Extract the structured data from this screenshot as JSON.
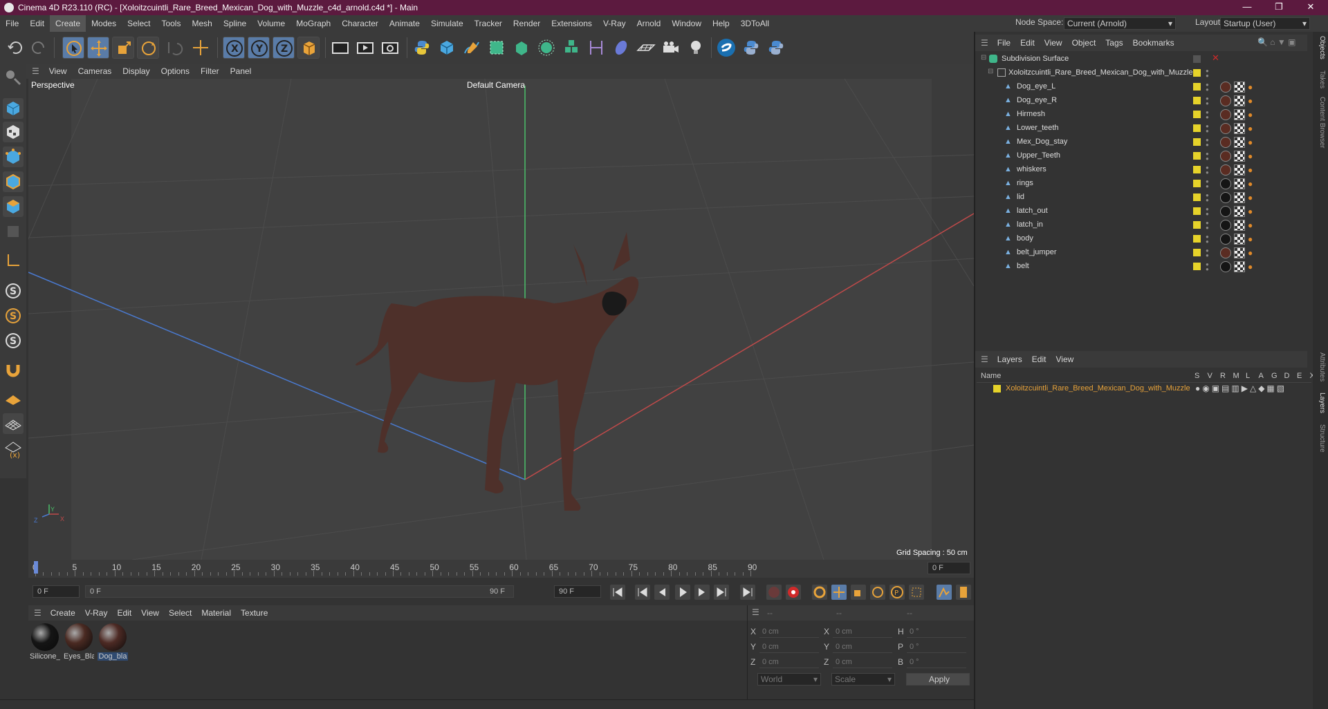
{
  "app": {
    "title": "Cinema 4D R23.110 (RC) - [Xoloitzcuintli_Rare_Breed_Mexican_Dog_with_Muzzle_c4d_arnold.c4d *] - Main"
  },
  "menubar": {
    "items": [
      "File",
      "Edit",
      "Create",
      "Modes",
      "Select",
      "Tools",
      "Mesh",
      "Spline",
      "Volume",
      "MoGraph",
      "Character",
      "Animate",
      "Simulate",
      "Tracker",
      "Render",
      "Extensions",
      "V-Ray",
      "Arnold",
      "Window",
      "Help",
      "3DToAll"
    ],
    "active": "Create",
    "node_space_label": "Node Space:",
    "node_space_value": "Current (Arnold)",
    "layout_label": "Layout:",
    "layout_value": "Startup (User)"
  },
  "viewport": {
    "menu": [
      "View",
      "Cameras",
      "Display",
      "Options",
      "Filter",
      "Panel"
    ],
    "view_name": "Perspective",
    "camera": "Default Camera",
    "grid_spacing": "Grid Spacing : 50 cm",
    "axis_x": "X",
    "axis_y": "Y",
    "axis_z": "Z"
  },
  "timeline": {
    "ticks": [
      "0",
      "5",
      "10",
      "15",
      "20",
      "25",
      "30",
      "35",
      "40",
      "45",
      "50",
      "55",
      "60",
      "65",
      "70",
      "75",
      "80",
      "85",
      "90"
    ],
    "current_frame": "0 F",
    "start_field": "0 F",
    "range_start": "0 F",
    "range_end": "90 F",
    "end_field": "90 F"
  },
  "materials": {
    "menu": [
      "Create",
      "V-Ray",
      "Edit",
      "View",
      "Select",
      "Material",
      "Texture"
    ],
    "items": [
      {
        "label": "Silicone_",
        "color": "#151515"
      },
      {
        "label": "Eyes_Bla",
        "color": "#4a2a22"
      },
      {
        "label": "Dog_bla",
        "color": "#4d2a24"
      }
    ]
  },
  "attributes": {
    "header": [
      "--",
      "--",
      "--"
    ],
    "rows": [
      {
        "a": "X",
        "av": "0 cm",
        "b": "X",
        "bv": "0 cm",
        "c": "H",
        "cv": "0 °"
      },
      {
        "a": "Y",
        "av": "0 cm",
        "b": "Y",
        "bv": "0 cm",
        "c": "P",
        "cv": "0 °"
      },
      {
        "a": "Z",
        "av": "0 cm",
        "b": "Z",
        "bv": "0 cm",
        "c": "B",
        "cv": "0 °"
      }
    ],
    "coord_mode": "World",
    "scale_mode": "Scale",
    "apply": "Apply"
  },
  "objects": {
    "menu": [
      "File",
      "Edit",
      "View",
      "Object",
      "Tags",
      "Bookmarks"
    ],
    "root": "Subdivision Surface",
    "group": "Xoloitzcuintli_Rare_Breed_Mexican_Dog_with_Muzzle",
    "children": [
      "Dog_eye_L",
      "Dog_eye_R",
      "Hirmesh",
      "Lower_teeth",
      "Mex_Dog_stay",
      "Upper_Teeth",
      "whiskers",
      "rings",
      "lid",
      "latch_out",
      "latch_in",
      "body",
      "belt_jumper",
      "belt"
    ]
  },
  "layers": {
    "menu": [
      "Layers",
      "Edit",
      "View"
    ],
    "name_header": "Name",
    "col_headers": [
      "S",
      "V",
      "R",
      "M",
      "L",
      "A",
      "G",
      "D",
      "E",
      "X"
    ],
    "items": [
      "Xoloitzcuintli_Rare_Breed_Mexican_Dog_with_Muzzle"
    ]
  },
  "side_tabs": [
    "Objects",
    "Takes",
    "Content Browser",
    "Attributes",
    "Layers",
    "Structure"
  ],
  "colors": {
    "title_bg": "#5c1a3f",
    "accent": "#e8a33a",
    "layer_yellow": "#e6d32a"
  }
}
